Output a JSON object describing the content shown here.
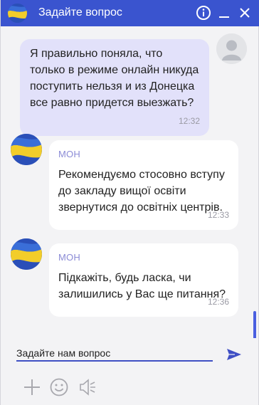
{
  "header": {
    "title": "Задайте вопрос",
    "icons": [
      "info-icon",
      "minimize-icon",
      "close-icon"
    ],
    "color": "#3a54cf"
  },
  "messages": [
    {
      "role": "user",
      "text": "Я правильно поняла, что только в режиме онлайн никуда поступить нельзя и из Донецка все равно придется выезжать?",
      "time": "12:32"
    },
    {
      "role": "bot",
      "sender": "МОН",
      "text": "Рекомендуємо стосовно вступу до закладу вищої освіти звернутися до освітніх центрів.",
      "time": "12:33"
    },
    {
      "role": "bot",
      "sender": "МОН",
      "text": "Підкажіть, будь ласка, чи залишились у Вас ще питання?",
      "time": "12:36"
    }
  ],
  "composer": {
    "placeholder": "Задайте нам вопрос",
    "send_icon": "send-icon",
    "tools": [
      "add-icon",
      "emoji-icon",
      "voice-icon"
    ]
  },
  "colors": {
    "user_bubble": "#e2e1fa",
    "bot_bubble": "#ffffff",
    "sender": "#8b8bd6",
    "accent": "#3a54cf"
  }
}
